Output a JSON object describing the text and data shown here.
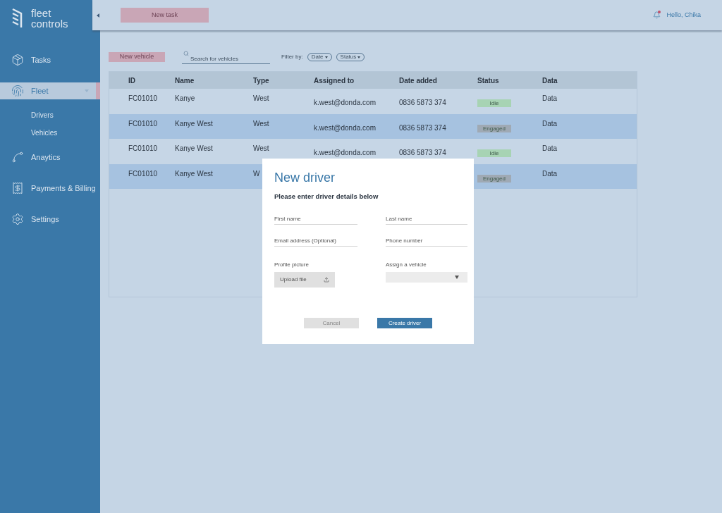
{
  "logo": {
    "line1": "fleet",
    "line2": "controls"
  },
  "sidebar": {
    "items": [
      {
        "label": "Tasks",
        "selected": false
      },
      {
        "label": "Fleet",
        "selected": true,
        "expanded": true,
        "children": [
          {
            "label": "Drivers"
          },
          {
            "label": "Vehicles"
          }
        ]
      },
      {
        "label": "Anaytics",
        "selected": false
      },
      {
        "label": "Payments & Billing",
        "selected": false
      },
      {
        "label": "Settings",
        "selected": false
      }
    ]
  },
  "header": {
    "new_task_button": "New task",
    "greeting": "Hello, Chika",
    "has_notification": true
  },
  "toolbar": {
    "new_vehicle_button": "New vehicle",
    "search": {
      "placeholder": "Search for vehicles"
    },
    "filter_label": "Filter by:",
    "filters": [
      "Date",
      "Status"
    ]
  },
  "table": {
    "columns": [
      "ID",
      "Name",
      "Type",
      "Assigned to",
      "Date added",
      "Status",
      "Data"
    ],
    "rows": [
      {
        "id": "FC01010",
        "name": "Kanye",
        "type": "West",
        "assigned_to": "k.west@donda.com",
        "date_added": "0836 5873 374",
        "status": {
          "label": "Idle",
          "color": "#a7d3b3"
        },
        "data": "Data"
      },
      {
        "id": "FC01010",
        "name": "Kanye West",
        "type": "West",
        "assigned_to": "k.west@donda.com",
        "date_added": "0836 5873 374",
        "status": {
          "label": "Engaged",
          "color": "#9fa9b4"
        },
        "data": "Data"
      },
      {
        "id": "FC01010",
        "name": "Kanye West",
        "type": "West",
        "assigned_to": "k.west@donda.com",
        "date_added": "0836 5873 374",
        "status": {
          "label": "Idle",
          "color": "#a7d3b3"
        },
        "data": "Data"
      },
      {
        "id": "FC01010",
        "name": "Kanye West",
        "type": "W",
        "status": {
          "label": "Engaged",
          "color": "#9fa9b4"
        },
        "data": "Data"
      }
    ]
  },
  "dialog": {
    "title": "New driver",
    "subtitle": "Please enter driver details below",
    "fields": [
      {
        "kind": "text",
        "label": "First name"
      },
      {
        "kind": "text",
        "label": "Last name"
      },
      {
        "kind": "text",
        "label": "Email address (Optional)"
      },
      {
        "kind": "text",
        "label": "Phone number"
      },
      {
        "kind": "upload",
        "label": "Profile picture",
        "button": "Upload file"
      },
      {
        "kind": "select",
        "label": "Assign a vehicle"
      }
    ],
    "cancel_button": "Cancel",
    "create_button": "Create driver"
  }
}
